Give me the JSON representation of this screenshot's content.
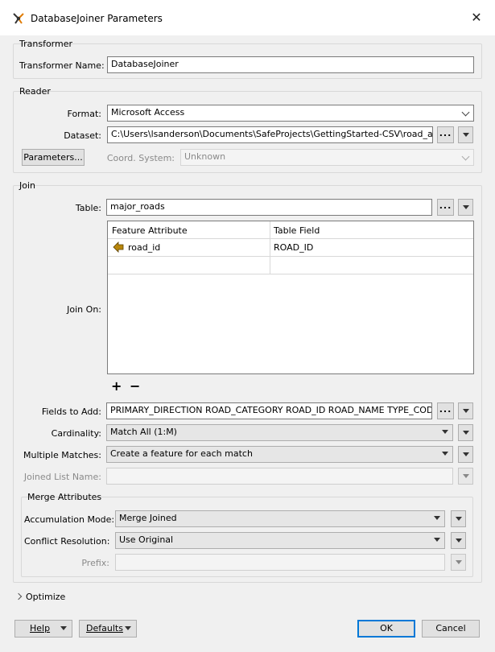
{
  "window": {
    "title": "DatabaseJoiner Parameters"
  },
  "transformer": {
    "group_title": "Transformer",
    "name_label": "Transformer Name:",
    "name_value": "DatabaseJoiner"
  },
  "reader": {
    "group_title": "Reader",
    "format_label": "Format:",
    "format_value": "Microsoft Access",
    "dataset_label": "Dataset:",
    "dataset_value": "C:\\Users\\lsanderson\\Documents\\SafeProjects\\GettingStarted-CSV\\road_attrs.mdb",
    "parameters_button": "Parameters...",
    "coord_label": "Coord. System:",
    "coord_value": "Unknown"
  },
  "join": {
    "group_title": "Join",
    "table_label": "Table:",
    "table_value": "major_roads",
    "join_on_label": "Join On:",
    "columns": [
      "Feature Attribute",
      "Table Field"
    ],
    "rows": [
      {
        "feature_attribute": "road_id",
        "table_field": "ROAD_ID"
      }
    ],
    "add_symbol": "+",
    "remove_symbol": "−",
    "fields_label": "Fields to Add:",
    "fields_value": "PRIMARY_DIRECTION ROAD_CATEGORY ROAD_ID ROAD_NAME TYPE_CODE",
    "cardinality_label": "Cardinality:",
    "cardinality_value": "Match All (1:M)",
    "multiple_label": "Multiple Matches:",
    "multiple_value": "Create a feature for each match",
    "joined_list_label": "Joined List Name:",
    "joined_list_value": ""
  },
  "merge": {
    "group_title": "Merge Attributes",
    "accum_label": "Accumulation Mode:",
    "accum_value": "Merge Joined",
    "conflict_label": "Conflict Resolution:",
    "conflict_value": "Use Original",
    "prefix_label": "Prefix:",
    "prefix_value": ""
  },
  "optimize": {
    "label": "Optimize"
  },
  "footer": {
    "help": "Help",
    "defaults": "Defaults",
    "ok": "OK",
    "cancel": "Cancel"
  },
  "colors": {
    "accent": "#0078d7",
    "attr_icon": "#b8860b"
  },
  "icons": {
    "app": "transformer-icon",
    "close": "close-icon",
    "attribute": "attribute-arrow-icon",
    "expand": "chevron-right-icon"
  }
}
